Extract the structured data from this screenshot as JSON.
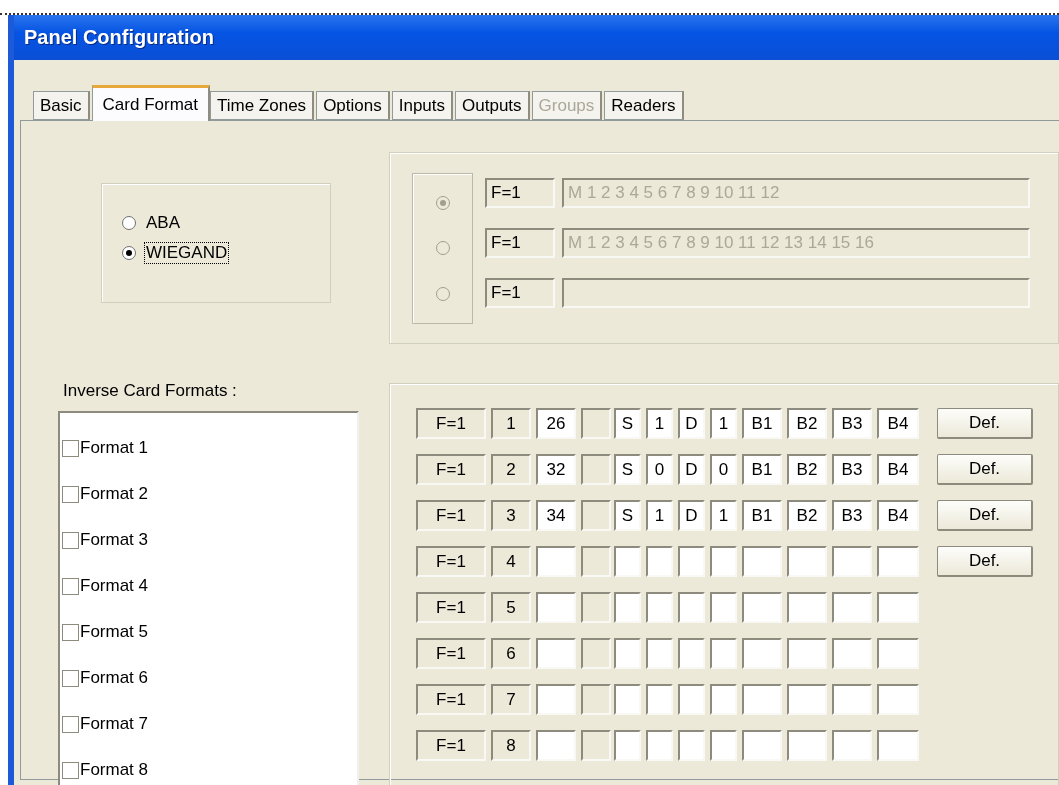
{
  "window": {
    "title": "Panel Configuration"
  },
  "tabs": [
    {
      "label": "Basic",
      "selected": false,
      "disabled": false
    },
    {
      "label": "Card Format",
      "selected": true,
      "disabled": false
    },
    {
      "label": "Time Zones",
      "selected": false,
      "disabled": false
    },
    {
      "label": "Options",
      "selected": false,
      "disabled": false
    },
    {
      "label": "Inputs",
      "selected": false,
      "disabled": false
    },
    {
      "label": "Outputs",
      "selected": false,
      "disabled": false
    },
    {
      "label": "Groups",
      "selected": false,
      "disabled": true
    },
    {
      "label": "Readers",
      "selected": false,
      "disabled": false
    }
  ],
  "card_type": [
    {
      "label": "ABA",
      "selected": false,
      "focused": false
    },
    {
      "label": "WIEGAND",
      "selected": true,
      "focused": true
    }
  ],
  "format_slots": [
    {
      "selected": true,
      "disabled": true,
      "code": "F=1",
      "value": "M 1 2 3 4 5 6 7 8 9 10 11 12"
    },
    {
      "selected": false,
      "disabled": true,
      "code": "F=1",
      "value": "M 1 2 3 4 5 6 7 8 9 10 11 12 13 14 15 16"
    },
    {
      "selected": false,
      "disabled": true,
      "code": "F=1"
    }
  ],
  "inverse_formats": {
    "label": "Inverse Card Formats :",
    "items": [
      {
        "label": "Format 1",
        "checked": false
      },
      {
        "label": "Format 2",
        "checked": false
      },
      {
        "label": "Format 3",
        "checked": false
      },
      {
        "label": "Format 4",
        "checked": false
      },
      {
        "label": "Format 5",
        "checked": false
      },
      {
        "label": "Format 6",
        "checked": false
      },
      {
        "label": "Format 7",
        "checked": false
      },
      {
        "label": "Format 8",
        "checked": false
      }
    ]
  },
  "format_table": [
    {
      "cells": [
        "F=1",
        "1",
        "26",
        "",
        "S",
        "1",
        "D",
        "1",
        "B1",
        "B2",
        "B3",
        "B4"
      ],
      "button": "Def."
    },
    {
      "cells": [
        "F=1",
        "2",
        "32",
        "",
        "S",
        "0",
        "D",
        "0",
        "B1",
        "B2",
        "B3",
        "B4"
      ],
      "button": "Def."
    },
    {
      "cells": [
        "F=1",
        "3",
        "34",
        "",
        "S",
        "1",
        "D",
        "1",
        "B1",
        "B2",
        "B3",
        "B4"
      ],
      "button": "Def."
    },
    {
      "cells": [
        "F=1",
        "4",
        "",
        "",
        "",
        "",
        "",
        "",
        "",
        "",
        "",
        ""
      ],
      "button": "Def."
    },
    {
      "cells": [
        "F=1",
        "5",
        "",
        "",
        "",
        "",
        "",
        "",
        "",
        "",
        "",
        ""
      ]
    },
    {
      "cells": [
        "F=1",
        "6",
        "",
        "",
        "",
        "",
        "",
        "",
        "",
        "",
        "",
        ""
      ]
    },
    {
      "cells": [
        "F=1",
        "7",
        "",
        "",
        "",
        "",
        "",
        "",
        "",
        "",
        "",
        ""
      ]
    },
    {
      "cells": [
        "F=1",
        "8",
        "",
        "",
        "",
        "",
        "",
        "",
        "",
        "",
        "",
        ""
      ]
    }
  ]
}
